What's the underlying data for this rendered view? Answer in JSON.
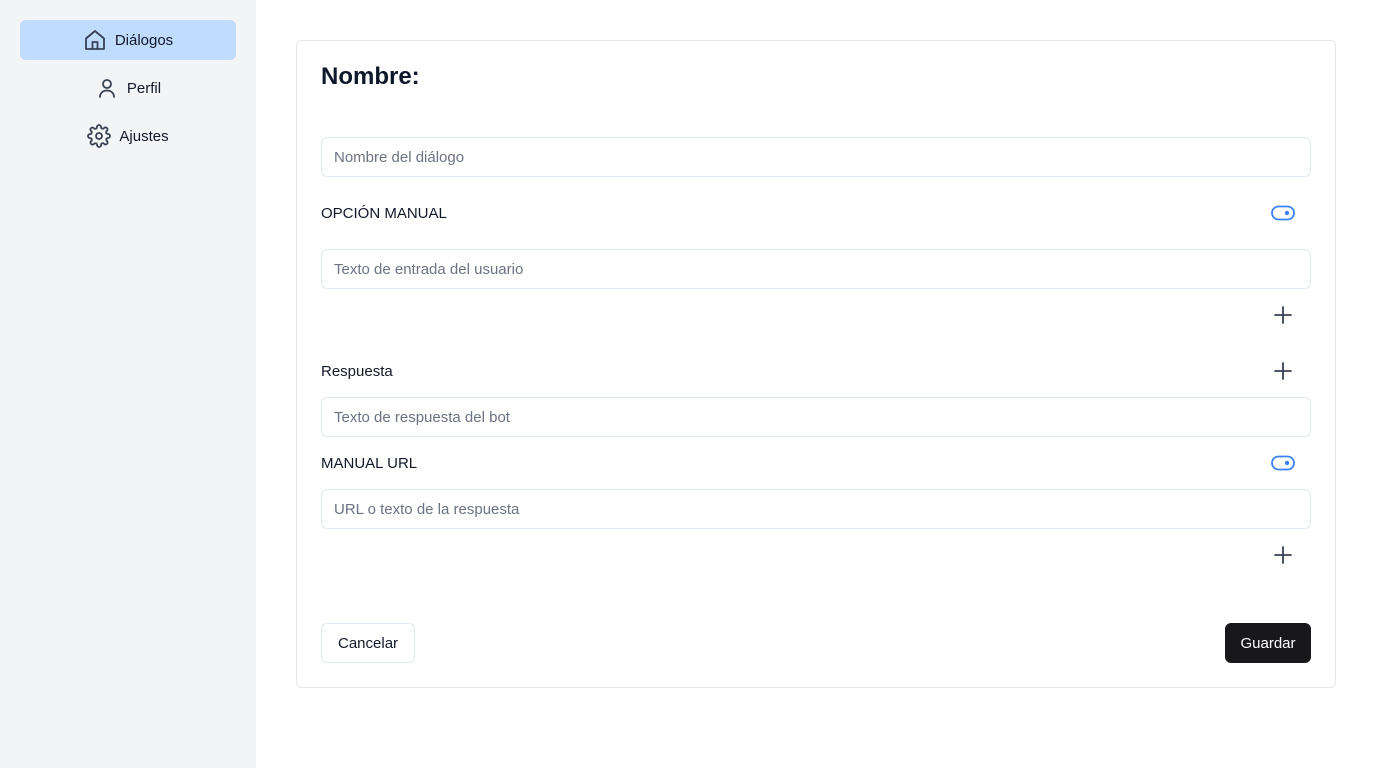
{
  "sidebar": {
    "items": [
      {
        "label": "Diálogos",
        "icon": "home-icon",
        "active": true
      },
      {
        "label": "Perfil",
        "icon": "user-icon",
        "active": false
      },
      {
        "label": "Ajustes",
        "icon": "gear-icon",
        "active": false
      }
    ]
  },
  "form": {
    "title": "Nombre:",
    "name_placeholder": "Nombre del diálogo",
    "manual_option_label": "OPCIÓN MANUAL",
    "user_input_placeholder": "Texto de entrada del usuario",
    "response_label": "Respuesta",
    "bot_response_placeholder": "Texto de respuesta del bot",
    "manual_url_label": "MANUAL URL",
    "url_placeholder": "URL o texto de la respuesta",
    "cancel_label": "Cancelar",
    "save_label": "Guardar"
  },
  "colors": {
    "accent": "#3b82f6",
    "active_nav_bg": "#bfdbfe",
    "primary_button": "#18181b"
  }
}
